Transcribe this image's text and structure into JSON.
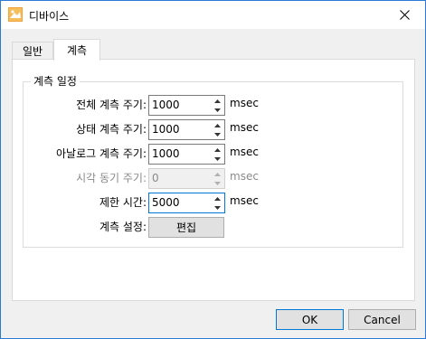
{
  "window": {
    "title": "디바이스"
  },
  "tabs": [
    {
      "label": "일반"
    },
    {
      "label": "계측"
    }
  ],
  "group": {
    "title": "계측 일정"
  },
  "rows": [
    {
      "label": "전체 계측 주기:",
      "value": "1000",
      "unit": "msec"
    },
    {
      "label": "상태 계측 주기:",
      "value": "1000",
      "unit": "msec"
    },
    {
      "label": "아날로그 계측 주기:",
      "value": "1000",
      "unit": "msec"
    },
    {
      "label": "시각 동기 주기:",
      "value": "0",
      "unit": "msec"
    },
    {
      "label": "제한 시간:",
      "value": "5000",
      "unit": "msec"
    }
  ],
  "settings": {
    "label": "계측 설정:",
    "button": "편집"
  },
  "footer": {
    "ok": "OK",
    "cancel": "Cancel"
  }
}
